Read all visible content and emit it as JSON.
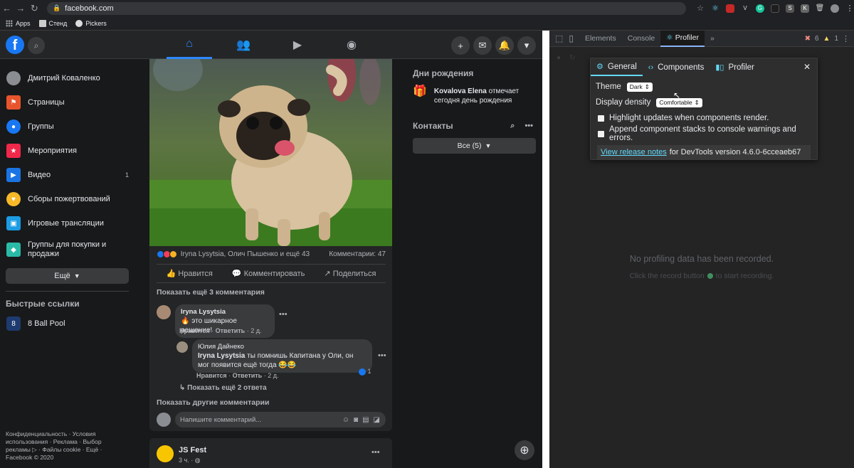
{
  "browser": {
    "url": "facebook.com",
    "bookmarks": [
      "Apps",
      "Стенд",
      "Pickers"
    ]
  },
  "facebook": {
    "sidebar": {
      "items": [
        {
          "label": "Дмитрий Коваленко",
          "badge": ""
        },
        {
          "label": "Страницы",
          "badge": ""
        },
        {
          "label": "Группы",
          "badge": ""
        },
        {
          "label": "Мероприятия",
          "badge": ""
        },
        {
          "label": "Видео",
          "badge": "1"
        },
        {
          "label": "Сборы пожертвований",
          "badge": ""
        },
        {
          "label": "Игровые трансляции",
          "badge": ""
        },
        {
          "label": "Группы для покупки и продажи",
          "badge": ""
        }
      ],
      "more_label": "Ещё",
      "shortcuts_title": "Быстрые ссылки",
      "shortcut": "8 Ball Pool",
      "footer": "Конфиденциальность · Условия использования · Реклама · Выбор рекламы ▷ · Файлы cookie · Ещё · Facebook © 2020"
    },
    "post": {
      "reactions_text": "Iryna Lysytsia, Олич Пышенко и ещё 43",
      "comments_count": "Комментарии: 47",
      "like_label": "Нравится",
      "comment_label": "Комментировать",
      "share_label": "Поделиться",
      "show_more_comments": "Показать ещё 3 комментария",
      "comment1": {
        "author": "Iryna Lysytsia",
        "text": "🔥 это шикарное решение!",
        "like": "Нравится",
        "reply": "Ответить",
        "time": "2 д."
      },
      "reply1": {
        "author": "Юлия Дайнеко",
        "mention": "Iryna Lysytsia",
        "text": "ты помнишь Капитана у Оли, он мог появится ещё тогда 😂😂",
        "like": "Нравится",
        "reply": "Ответить",
        "time": "2 д.",
        "likes": "1"
      },
      "show_replies": "Показать ещё 2 ответа",
      "show_other": "Показать другие комментарии",
      "input_placeholder": "Напишите комментарий..."
    },
    "post2": {
      "author": "JS Fest",
      "time": "3 ч. ·"
    },
    "right": {
      "birthdays_title": "Дни рождения",
      "birthday_name": "Kovalova Elena",
      "birthday_text": "отмечает сегодня день рождения",
      "contacts_title": "Контакты",
      "all_button": "Все (5)"
    }
  },
  "devtools": {
    "tabs": [
      "Elements",
      "Console",
      "Profiler"
    ],
    "active_tab": "Profiler",
    "errors": "6",
    "warnings": "1",
    "empty_title": "No profiling data has been recorded.",
    "empty_hint_before": "Click the record button",
    "empty_hint_after": "to start recording.",
    "settings": {
      "tabs": [
        "General",
        "Components",
        "Profiler"
      ],
      "theme_label": "Theme",
      "theme_value": "Dark",
      "density_label": "Display density",
      "density_value": "Comfortable",
      "opt1": "Highlight updates when components render.",
      "opt2": "Append component stacks to console warnings and errors.",
      "release_link": "View release notes",
      "release_text": "for DevTools version 4.6.0-6cceaeb67"
    }
  }
}
